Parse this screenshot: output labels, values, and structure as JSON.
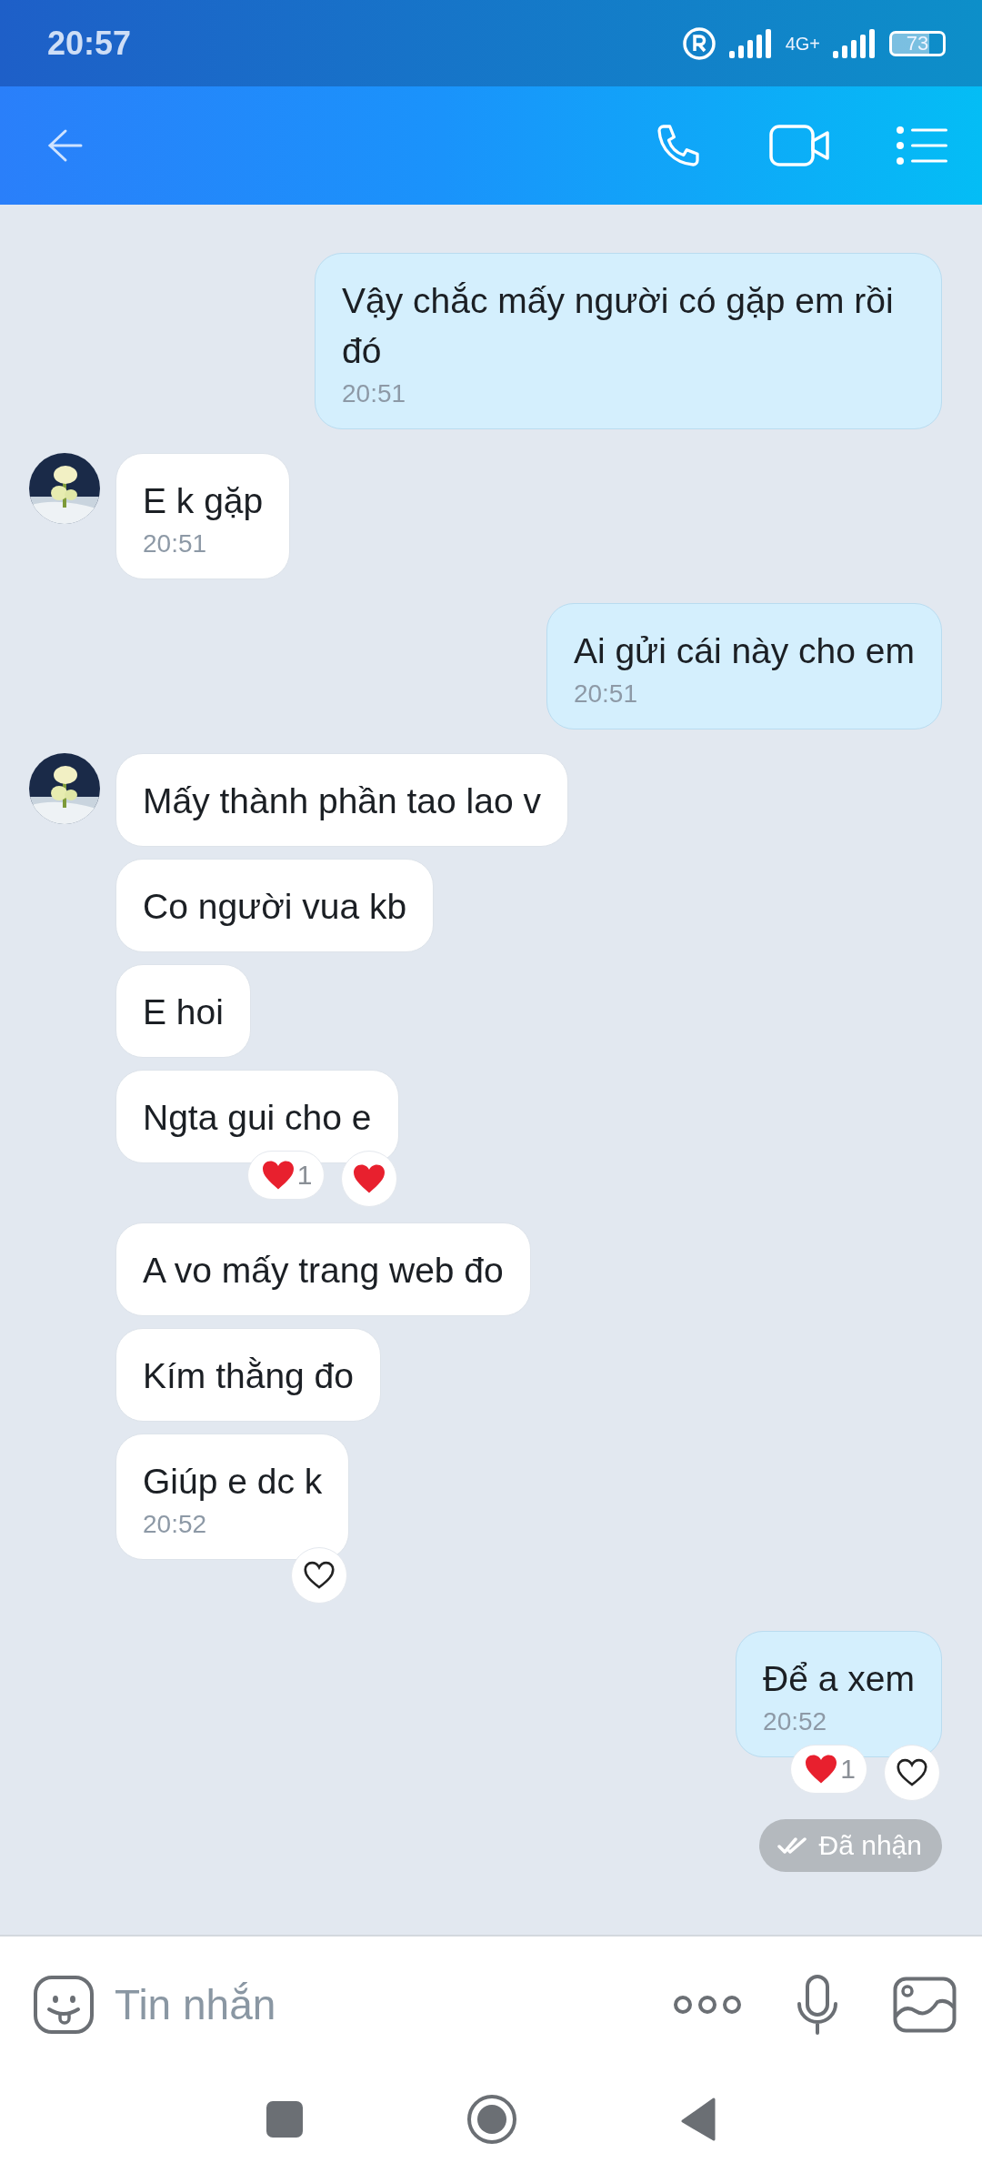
{
  "status_bar": {
    "time": "20:57",
    "network": "4G+",
    "battery": "73"
  },
  "messages": [
    {
      "kind": "sent",
      "text": "Vậy chắc mấy người có gặp em rồi đó",
      "time": "20:51"
    },
    {
      "kind": "received",
      "avatar": true,
      "text": "E k gặp",
      "time": "20:51"
    },
    {
      "kind": "sent",
      "text": "Ai gửi cái này cho em",
      "time": "20:51"
    },
    {
      "kind": "received",
      "avatar": true,
      "text": "Mấy thành phần tao lao v"
    },
    {
      "kind": "received",
      "avatar": false,
      "text": "Co người vua kb"
    },
    {
      "kind": "received",
      "avatar": false,
      "text": "E hoi"
    },
    {
      "kind": "received",
      "avatar": false,
      "text": "Ngta gui cho e",
      "reactions": [
        {
          "kind": "count",
          "count": "1"
        },
        {
          "kind": "react",
          "filled": true
        }
      ]
    },
    {
      "kind": "received",
      "avatar": false,
      "text": "A vo mấy trang web đo"
    },
    {
      "kind": "received",
      "avatar": false,
      "text": "Kím thằng đo"
    },
    {
      "kind": "received",
      "avatar": false,
      "text": "Giúp e dc k",
      "time": "20:52",
      "reactions": [
        {
          "kind": "react",
          "filled": false
        }
      ]
    },
    {
      "kind": "sent",
      "text": "Để a xem",
      "time": "20:52",
      "reactions": [
        {
          "kind": "count",
          "count": "1"
        },
        {
          "kind": "react",
          "filled": false
        }
      ]
    }
  ],
  "receipt": "Đã nhận",
  "composer": {
    "placeholder": "Tin nhắn"
  }
}
